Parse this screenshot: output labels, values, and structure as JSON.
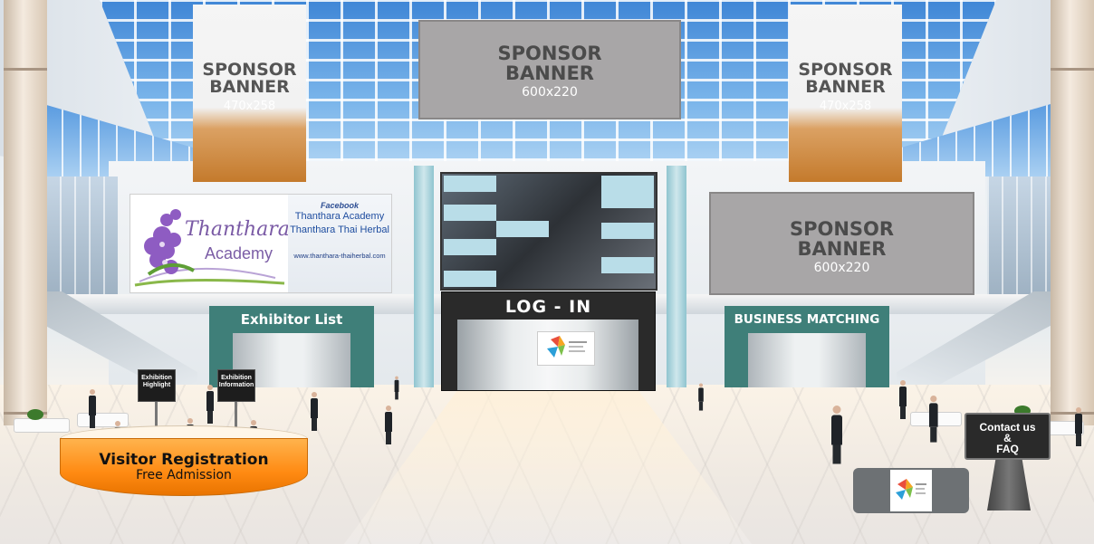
{
  "sponsor_banners": [
    {
      "title_line1": "SPONSOR",
      "title_line2": "BANNER",
      "size": "470x258"
    },
    {
      "title_line1": "SPONSOR",
      "title_line2": "BANNER",
      "size": "600x220"
    },
    {
      "title_line1": "SPONSOR",
      "title_line2": "BANNER",
      "size": "600x220"
    },
    {
      "title_line1": "SPONSOR",
      "title_line2": "BANNER",
      "size": "470x258"
    }
  ],
  "academy_board": {
    "logo_word": "Thanthara",
    "logo_sub": "Academy",
    "facebook_label": "Facebook",
    "page_names": [
      "Thanthara Academy",
      "Thanthara Thai Herbal"
    ],
    "url": "www.thanthara-thaiherbal.com"
  },
  "exhibitor_list": {
    "label": "Exhibitor List"
  },
  "login": {
    "label": "LOG - IN"
  },
  "business_matching": {
    "label": "BUSINESS MATCHING"
  },
  "signs": {
    "exhibition_highlight": [
      "Exhibition",
      "Highlight"
    ],
    "exhibition_information": [
      "Exhibition",
      "Information"
    ]
  },
  "visitor_registration": {
    "title": "Visitor Registration",
    "subtitle": "Free Admission"
  },
  "contact": {
    "line1": "Contact us",
    "line2": "&",
    "line3": "FAQ"
  },
  "colors": {
    "banner_grey": "#a8a6a7",
    "banner_orange": "#c47a2c",
    "booth_teal": "#3f7f79",
    "registration_orange": "#ff8a12",
    "academy_purple": "#7a5aa5"
  }
}
